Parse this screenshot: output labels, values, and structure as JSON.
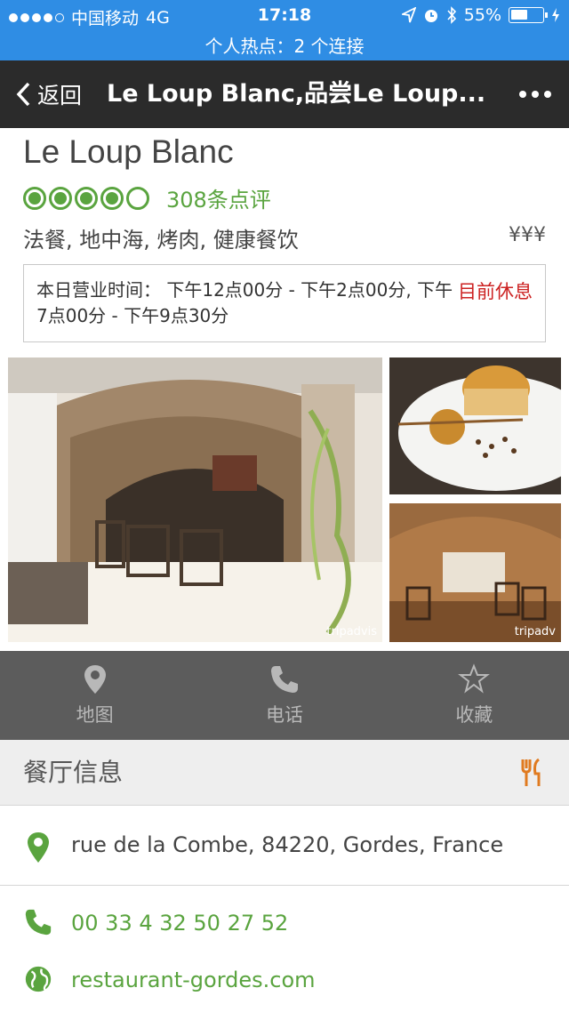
{
  "status_bar": {
    "carrier": "中国移动",
    "network": "4G",
    "time": "17:18",
    "battery": "55%",
    "battery_level": 0.55,
    "hotspot": "个人热点：2 个连接"
  },
  "nav": {
    "back_label": "返回",
    "title": "Le Loup Blanc,品尝Le Loup..."
  },
  "restaurant": {
    "name": "Le Loup Blanc",
    "rating": 4,
    "rating_max": 5,
    "reviews": "308条点评",
    "cuisine": "法餐, 地中海, 烤肉, 健康餐饮",
    "price": "¥¥¥",
    "hours_text": "本日营业时间：  下午12点00分 - 下午2点00分, 下午7点00分 - 下午9点30分",
    "status": "目前休息"
  },
  "photos": {
    "watermark": "tripadvis",
    "watermark_interior": "tripadv"
  },
  "actions": [
    {
      "label": "地图",
      "icon": "map-pin-icon"
    },
    {
      "label": "电话",
      "icon": "phone-icon"
    },
    {
      "label": "收藏",
      "icon": "star-icon"
    }
  ],
  "info": {
    "title": "餐厅信息",
    "address": "rue de la Combe, 84220, Gordes, France",
    "phone": "00 33 4 32 50 27 52",
    "website": "restaurant-gordes.com"
  },
  "colors": {
    "status_bar": "#2f8de4",
    "nav_bar": "#2b2b2b",
    "rating_green": "#5aa43f",
    "closed_red": "#cc2222",
    "fork_orange": "#e07a1f"
  }
}
